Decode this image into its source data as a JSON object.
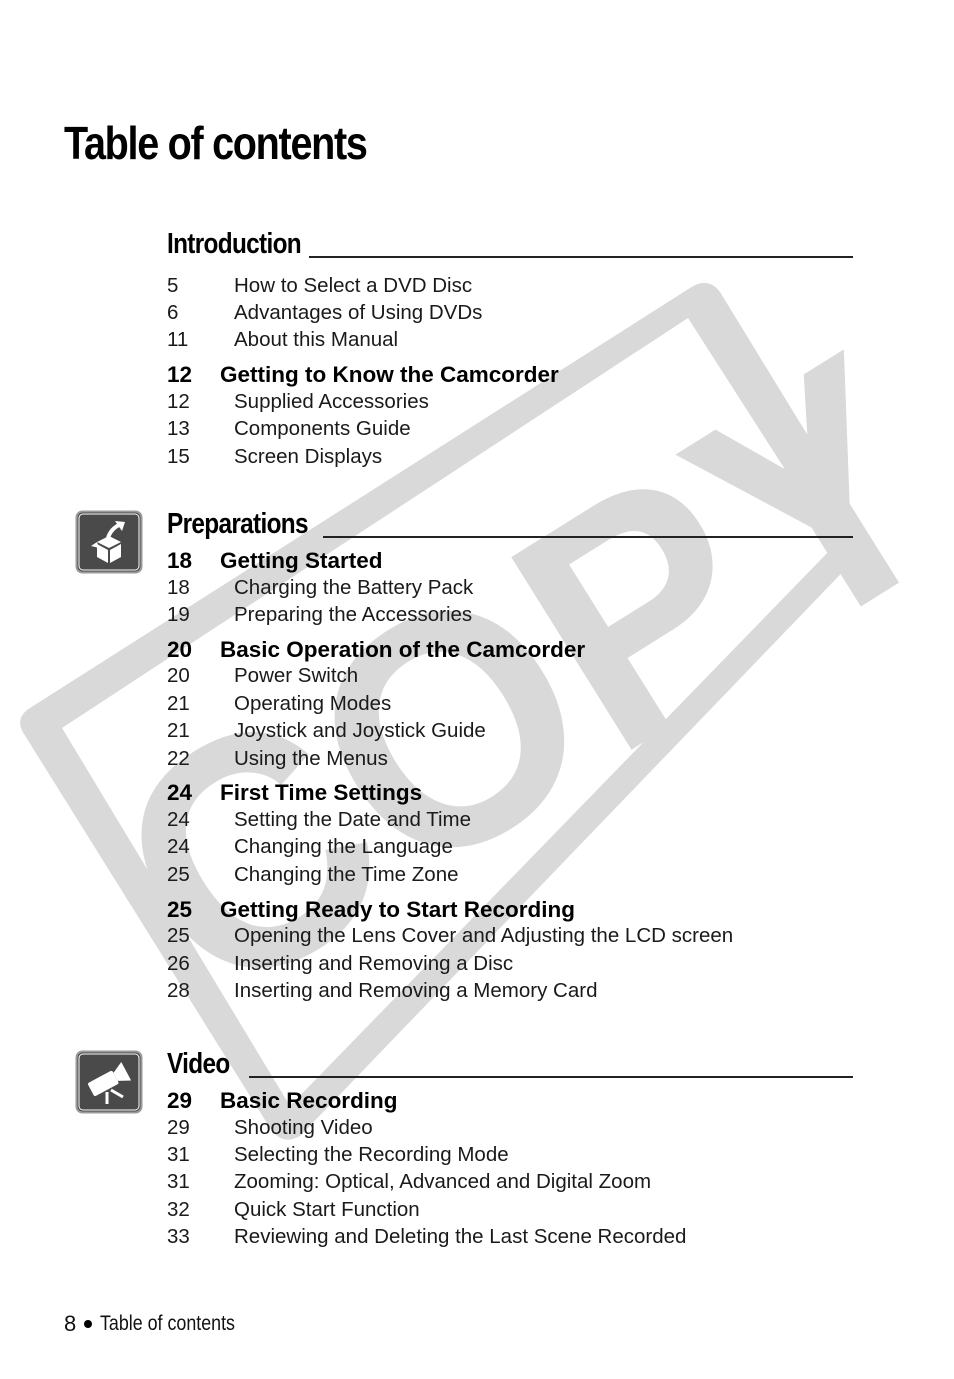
{
  "page": {
    "title": "Table of contents",
    "watermark_text": "COPY",
    "watermark_color": "#d9d9d9",
    "icon_bg_color": "#4a4a4a"
  },
  "sections": [
    {
      "title": "Introduction",
      "icon": null,
      "groups": [
        {
          "heading": null,
          "entries": [
            {
              "page": "5",
              "title": "How to Select a DVD Disc"
            },
            {
              "page": "6",
              "title": "Advantages of Using DVDs"
            },
            {
              "page": "11",
              "title": "About this Manual"
            }
          ]
        },
        {
          "heading": {
            "page": "12",
            "title": "Getting to Know the Camcorder"
          },
          "entries": [
            {
              "page": "12",
              "title": "Supplied Accessories"
            },
            {
              "page": "13",
              "title": "Components Guide"
            },
            {
              "page": "15",
              "title": "Screen Displays"
            }
          ]
        }
      ]
    },
    {
      "title": "Preparations",
      "icon": "open-box-icon",
      "groups": [
        {
          "heading": {
            "page": "18",
            "title": "Getting Started"
          },
          "entries": [
            {
              "page": "18",
              "title": "Charging the Battery Pack"
            },
            {
              "page": "19",
              "title": "Preparing the Accessories"
            }
          ]
        },
        {
          "heading": {
            "page": "20",
            "title": "Basic Operation of the Camcorder"
          },
          "entries": [
            {
              "page": "20",
              "title": "Power Switch"
            },
            {
              "page": "21",
              "title": "Operating Modes"
            },
            {
              "page": "21",
              "title": "Joystick and Joystick Guide"
            },
            {
              "page": "22",
              "title": "Using the Menus"
            }
          ]
        },
        {
          "heading": {
            "page": "24",
            "title": "First Time Settings"
          },
          "entries": [
            {
              "page": "24",
              "title": "Setting the Date and Time"
            },
            {
              "page": "24",
              "title": "Changing the Language"
            },
            {
              "page": "25",
              "title": "Changing the Time Zone"
            }
          ]
        },
        {
          "heading": {
            "page": "25",
            "title": "Getting Ready to Start Recording"
          },
          "entries": [
            {
              "page": "25",
              "title": "Opening the Lens Cover and Adjusting the LCD screen"
            },
            {
              "page": "26",
              "title": "Inserting and Removing a Disc"
            },
            {
              "page": "28",
              "title": "Inserting and Removing a Memory Card"
            }
          ]
        }
      ]
    },
    {
      "title": "Video",
      "icon": "video-camera-icon",
      "groups": [
        {
          "heading": {
            "page": "29",
            "title": "Basic Recording"
          },
          "entries": [
            {
              "page": "29",
              "title": "Shooting Video"
            },
            {
              "page": "31",
              "title": "Selecting the Recording Mode"
            },
            {
              "page": "31",
              "title": "Zooming: Optical, Advanced and Digital Zoom"
            },
            {
              "page": "32",
              "title": "Quick Start Function"
            },
            {
              "page": "33",
              "title": "Reviewing and Deleting the Last Scene Recorded"
            }
          ]
        }
      ]
    }
  ],
  "footer": {
    "page_number": "8",
    "label": "Table of contents"
  }
}
